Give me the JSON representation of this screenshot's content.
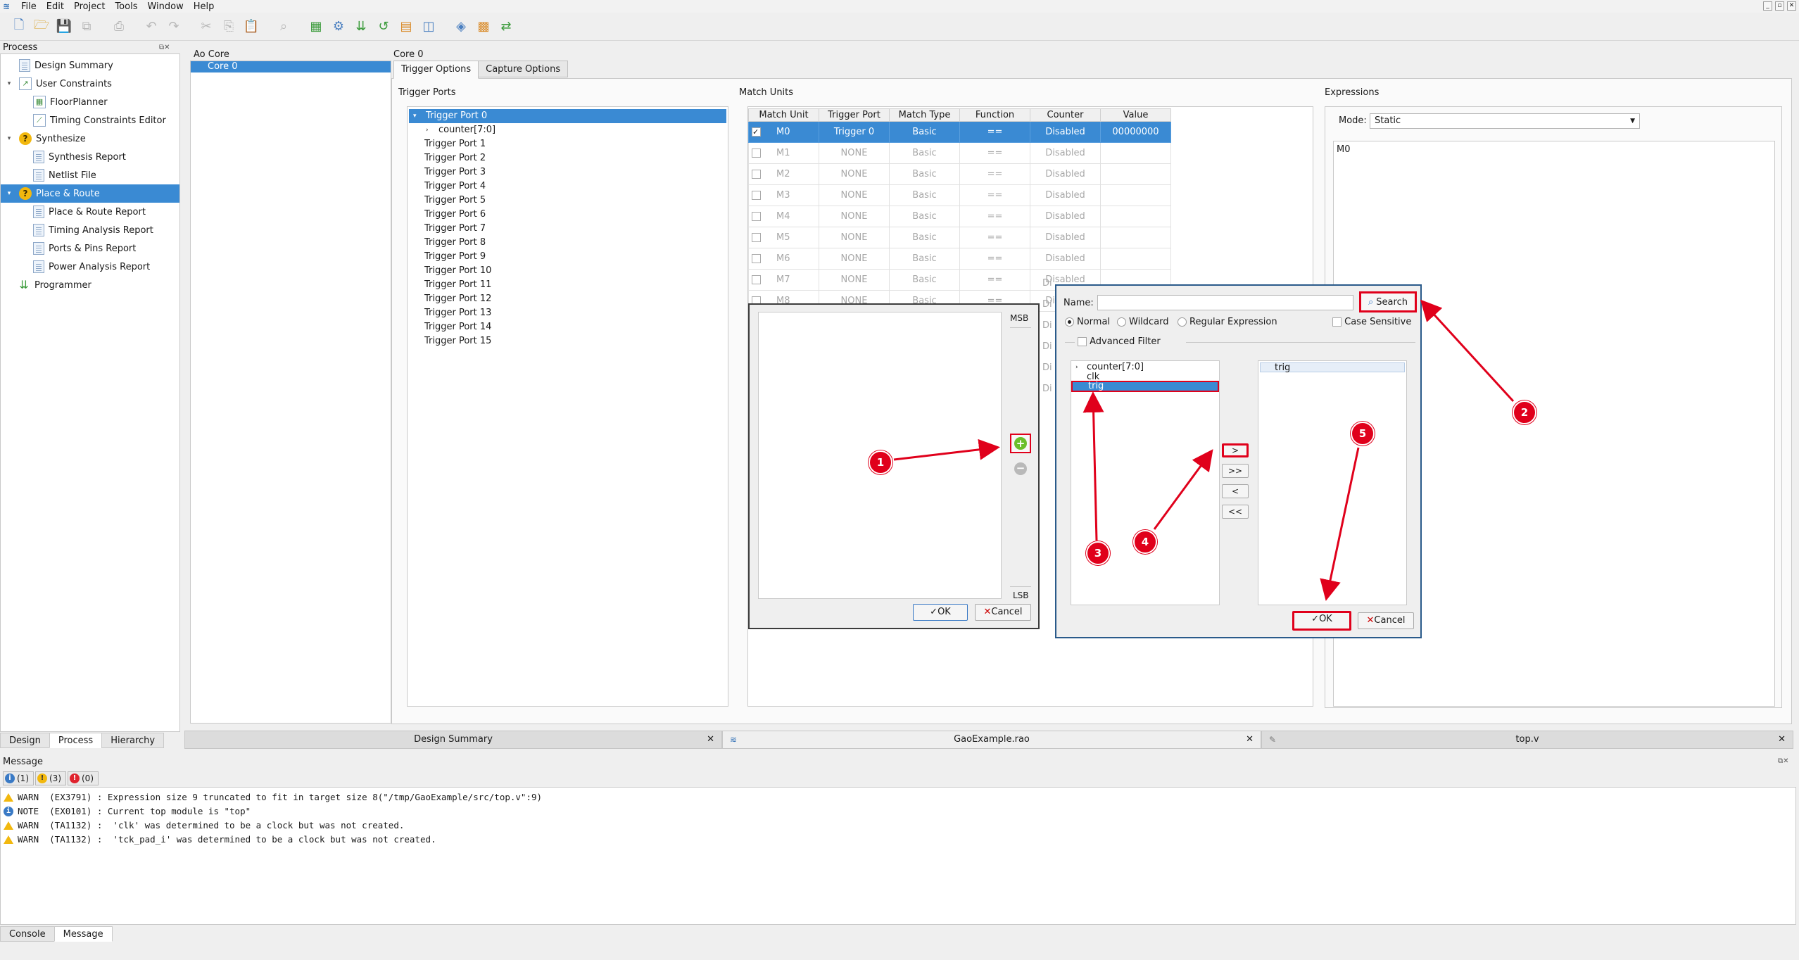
{
  "menu": [
    "File",
    "Edit",
    "Project",
    "Tools",
    "Window",
    "Help"
  ],
  "process": {
    "title": "Process",
    "items": [
      {
        "label": "Design Summary",
        "icon": "document-icon"
      },
      {
        "label": "User Constraints",
        "icon": "constraints-icon"
      },
      {
        "label": "FloorPlanner",
        "icon": "floorplanner-icon"
      },
      {
        "label": "Timing Constraints Editor",
        "icon": "timing-editor-icon"
      },
      {
        "label": "Synthesize",
        "icon": "question-icon"
      },
      {
        "label": "Synthesis Report",
        "icon": "document-icon"
      },
      {
        "label": "Netlist File",
        "icon": "document-icon"
      },
      {
        "label": "Place & Route",
        "icon": "question-icon"
      },
      {
        "label": "Place & Route Report",
        "icon": "document-icon"
      },
      {
        "label": "Timing Analysis Report",
        "icon": "document-icon"
      },
      {
        "label": "Ports & Pins Report",
        "icon": "document-icon"
      },
      {
        "label": "Power Analysis Report",
        "icon": "document-icon"
      },
      {
        "label": "Programmer",
        "icon": "programmer-icon"
      }
    ],
    "tabs": [
      "Design",
      "Process",
      "Hierarchy"
    ]
  },
  "ao_core": {
    "title": "Ao Core",
    "item": "Core 0"
  },
  "core": {
    "title": "Core 0",
    "tabs": [
      "Trigger Options",
      "Capture Options"
    ],
    "trigger_ports_title": "Trigger Ports",
    "trigger_ports": [
      "Trigger Port 0",
      "counter[7:0]",
      "Trigger Port 1",
      "Trigger Port 2",
      "Trigger Port 3",
      "Trigger Port 4",
      "Trigger Port 5",
      "Trigger Port 6",
      "Trigger Port 7",
      "Trigger Port 8",
      "Trigger Port 9",
      "Trigger Port 10",
      "Trigger Port 11",
      "Trigger Port 12",
      "Trigger Port 13",
      "Trigger Port 14",
      "Trigger Port 15"
    ],
    "match_units_title": "Match Units",
    "match_columns": [
      "Match Unit",
      "Trigger Port",
      "Match Type",
      "Function",
      "Counter",
      "Value"
    ],
    "match_rows": [
      {
        "unit": "M0",
        "port": "Trigger 0",
        "type": "Basic",
        "func": "==",
        "counter": "Disabled",
        "value": "00000000",
        "checked": "✓"
      },
      {
        "unit": "M1",
        "port": "NONE",
        "type": "Basic",
        "func": "==",
        "counter": "Disabled",
        "value": "",
        "checked": ""
      },
      {
        "unit": "M2",
        "port": "NONE",
        "type": "Basic",
        "func": "==",
        "counter": "Disabled",
        "value": "",
        "checked": ""
      },
      {
        "unit": "M3",
        "port": "NONE",
        "type": "Basic",
        "func": "==",
        "counter": "Disabled",
        "value": "",
        "checked": ""
      },
      {
        "unit": "M4",
        "port": "NONE",
        "type": "Basic",
        "func": "==",
        "counter": "Disabled",
        "value": "",
        "checked": ""
      },
      {
        "unit": "M5",
        "port": "NONE",
        "type": "Basic",
        "func": "==",
        "counter": "Disabled",
        "value": "",
        "checked": ""
      },
      {
        "unit": "M6",
        "port": "NONE",
        "type": "Basic",
        "func": "==",
        "counter": "Disabled",
        "value": "",
        "checked": ""
      },
      {
        "unit": "M7",
        "port": "NONE",
        "type": "Basic",
        "func": "==",
        "counter": "Disabled",
        "value": "",
        "checked": ""
      },
      {
        "unit": "M8",
        "port": "NONE",
        "type": "Basic",
        "func": "==",
        "counter": "Disabled",
        "value": "",
        "checked": ""
      }
    ],
    "hidden_disabled_stub": "Di",
    "expressions_title": "Expressions",
    "mode_label": "Mode:",
    "mode_value": "Static",
    "expression_text": "M0"
  },
  "bit_dialog": {
    "msb": "MSB",
    "lsb": "LSB",
    "ok": "OK",
    "cancel": "Cancel"
  },
  "search_dialog": {
    "name_label": "Name:",
    "name_value": "",
    "search_button": "Search",
    "options": [
      "Normal",
      "Wildcard",
      "Regular Expression"
    ],
    "case_sensitive": "Case Sensitive",
    "advanced_filter": "Advanced Filter",
    "source": [
      "counter[7:0]",
      "clk",
      "trig"
    ],
    "selected": [
      "trig"
    ],
    "move_buttons": [
      ">",
      ">>",
      "<",
      "<<"
    ],
    "ok": "OK",
    "cancel": "Cancel"
  },
  "annotations": [
    "1",
    "2",
    "3",
    "4",
    "5"
  ],
  "doc_tabs": [
    "Design Summary",
    "GaoExample.rao",
    "top.v"
  ],
  "messages": {
    "title": "Message",
    "filters": [
      {
        "count": "(1)",
        "color": "#3a7ac5"
      },
      {
        "count": "(3)",
        "color": "#f2b80e"
      },
      {
        "count": "(0)",
        "color": "#e0232e"
      }
    ],
    "rows": [
      {
        "type": "warn",
        "text": "WARN  (EX3791) : Expression size 9 truncated to fit in target size 8(\"/tmp/GaoExample/src/top.v\":9)"
      },
      {
        "type": "note",
        "text": "NOTE  (EX0101) : Current top module is \"top\""
      },
      {
        "type": "warn",
        "text": "WARN  (TA1132) :  'clk' was determined to be a clock but was not created."
      },
      {
        "type": "warn",
        "text": "WARN  (TA1132) :  'tck_pad_i' was determined to be a clock but was not created."
      }
    ]
  },
  "bottom_tabs": [
    "Console",
    "Message"
  ],
  "colors": {
    "selection": "#3a8ad3",
    "annotation": "#e0001b"
  }
}
